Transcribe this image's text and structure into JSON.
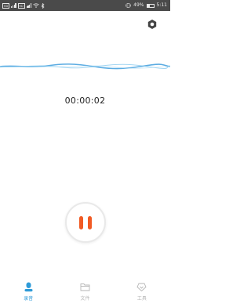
{
  "status_bar": {
    "carrier_badges": [
      "HD",
      "HD"
    ],
    "battery_text": "49%",
    "time": "5:11"
  },
  "recorder": {
    "timer": "00:00:02",
    "accent_color": "#f15a24",
    "wave_color": "#4aa3df"
  },
  "bottom_nav": {
    "active_color": "#2f9bd8",
    "items": [
      {
        "label": "录音",
        "icon": "microphone-icon",
        "active": true
      },
      {
        "label": "文件",
        "icon": "folder-icon",
        "active": false
      },
      {
        "label": "工具",
        "icon": "toolbox-icon",
        "active": false
      }
    ]
  }
}
